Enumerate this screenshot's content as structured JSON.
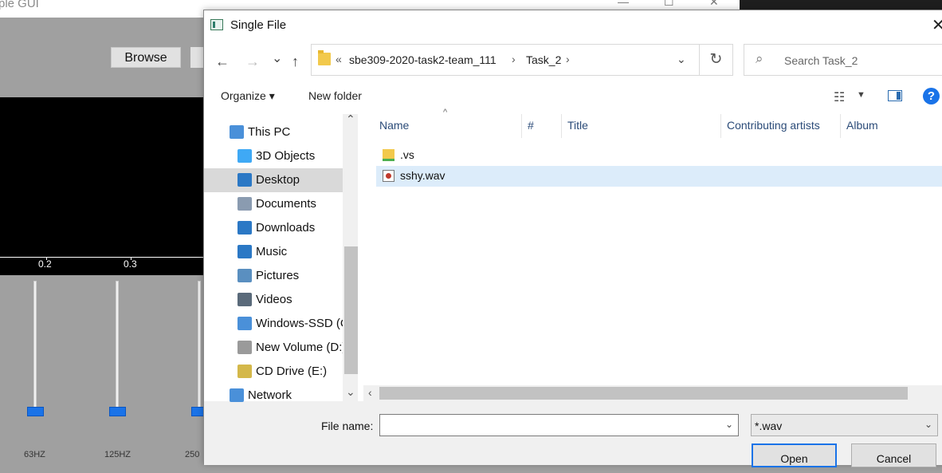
{
  "background_app": {
    "title": "ple GUI",
    "browse_label": "Browse",
    "axis_ticks": [
      "0.2",
      "0.3"
    ],
    "slider_labels": [
      "63HZ",
      "125HZ",
      "250"
    ]
  },
  "dialog": {
    "title": "Single File",
    "close_glyph": "✕",
    "nav_buttons": {
      "back": "←",
      "forward": "→",
      "recent": "⌄",
      "up": "↑"
    },
    "address": {
      "overflow": "«",
      "crumbs": [
        "sbe309-2020-task2-team_111",
        "Task_2"
      ],
      "separator": "›",
      "dropdown": "⌄",
      "refresh": "↻"
    },
    "search": {
      "placeholder": "Search Task_2",
      "icon": "search-icon"
    },
    "toolbar": {
      "organize": "Organize ▾",
      "new_folder": "New folder",
      "help": "?"
    },
    "nav_items": [
      {
        "label": "This PC",
        "icon": "this-pc-icon",
        "color": "#4a90d9"
      },
      {
        "label": "3D Objects",
        "icon": "cube-icon",
        "color": "#3fa9f5"
      },
      {
        "label": "Desktop",
        "icon": "desktop-icon",
        "color": "#2b78c5",
        "selected": true
      },
      {
        "label": "Documents",
        "icon": "document-icon",
        "color": "#8a9bb0"
      },
      {
        "label": "Downloads",
        "icon": "download-icon",
        "color": "#2b78c5"
      },
      {
        "label": "Music",
        "icon": "music-icon",
        "color": "#2b78c5"
      },
      {
        "label": "Pictures",
        "icon": "pictures-icon",
        "color": "#5a8fc0"
      },
      {
        "label": "Videos",
        "icon": "videos-icon",
        "color": "#5a6a7a"
      },
      {
        "label": "Windows-SSD (C",
        "icon": "drive-icon",
        "color": "#4a90d9"
      },
      {
        "label": "New Volume (D:)",
        "icon": "drive-icon",
        "color": "#9a9a9a"
      },
      {
        "label": "CD Drive (E:)",
        "icon": "cd-icon",
        "color": "#d4b84a"
      },
      {
        "label": "Network",
        "icon": "network-icon",
        "color": "#4a90d9"
      }
    ],
    "columns": [
      "Name",
      "#",
      "Title",
      "Contributing artists",
      "Album"
    ],
    "files": [
      {
        "name": ".vs",
        "icon": "folder-icon",
        "selected": false
      },
      {
        "name": "sshy.wav",
        "icon": "audio-file-icon",
        "selected": true
      }
    ],
    "file_name_label": "File name:",
    "file_name_value": "",
    "file_type": "*.wav",
    "open_label": "Open",
    "cancel_label": "Cancel"
  }
}
